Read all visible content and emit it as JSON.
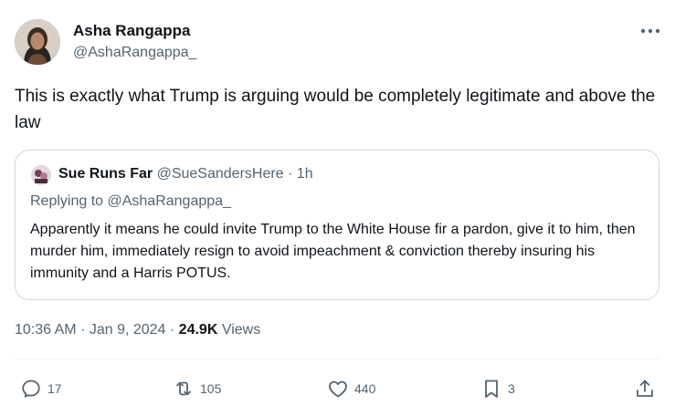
{
  "author": {
    "name": "Asha Rangappa",
    "handle": "@AshaRangappa_"
  },
  "tweet": {
    "text": "This is exactly what Trump is arguing would be completely legitimate and above the law"
  },
  "quote": {
    "name": "Sue Runs Far",
    "handle": "@SueSandersHere",
    "separator": " · ",
    "time": "1h",
    "replying_to": "Replying to @AshaRangappa_",
    "text": "Apparently it means he could invite Trump to the White House fir a pardon, give it to him, then murder him, immediately resign to avoid impeachment & conviction thereby insuring his immunity and a Harris POTUS."
  },
  "meta": {
    "time": "10:36 AM",
    "separator": " · ",
    "date": "Jan 9, 2024",
    "views_count": "24.9K",
    "views_label": " Views"
  },
  "actions": {
    "replies": "17",
    "reposts": "105",
    "likes": "440",
    "bookmarks": "3"
  },
  "colors": {
    "text": "#0f1419",
    "muted": "#536471",
    "border": "#cfd9de"
  },
  "icons": [
    "more-icon",
    "reply-icon",
    "repost-icon",
    "like-icon",
    "bookmark-icon",
    "share-icon"
  ]
}
